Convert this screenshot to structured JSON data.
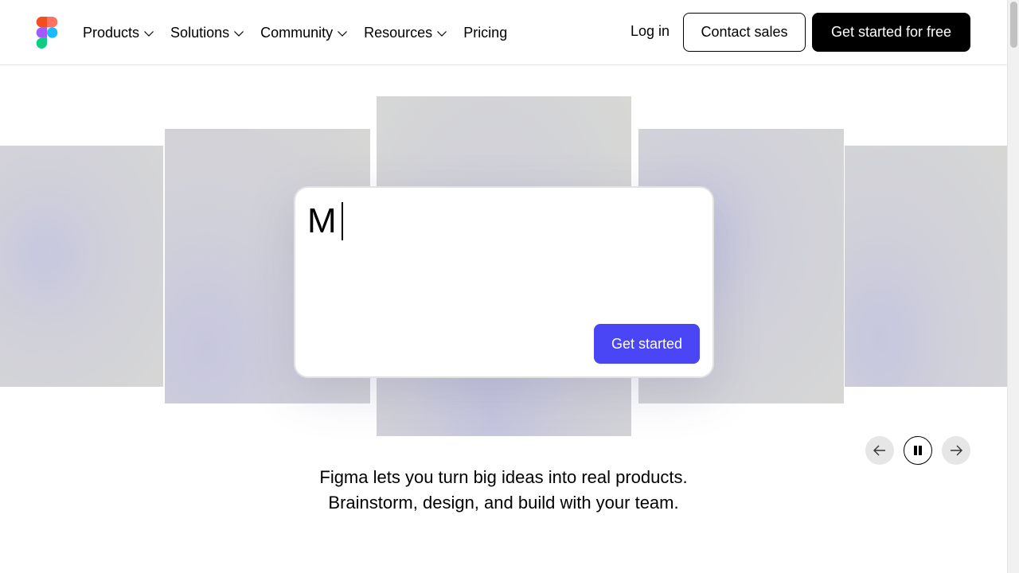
{
  "header": {
    "nav": [
      {
        "label": "Products",
        "has_dropdown": true
      },
      {
        "label": "Solutions",
        "has_dropdown": true
      },
      {
        "label": "Community",
        "has_dropdown": true
      },
      {
        "label": "Resources",
        "has_dropdown": true
      },
      {
        "label": "Pricing",
        "has_dropdown": false
      }
    ],
    "login_label": "Log in",
    "contact_label": "Contact sales",
    "cta_label": "Get started for free"
  },
  "hero": {
    "prompt_value": "M",
    "submit_label": "Get started",
    "tagline_line1": "Figma lets you turn big ideas into real products.",
    "tagline_line2": "Brainstorm, design, and build with your team."
  },
  "carousel": {
    "controls": [
      "arrow-left-icon",
      "pause-icon",
      "arrow-right-icon"
    ]
  },
  "colors": {
    "accent": "#4a46f5",
    "cta_bg": "#000000",
    "logo_red": "#f24e1e",
    "logo_orange": "#ff7262",
    "logo_purple": "#a259ff",
    "logo_blue": "#1abcfe",
    "logo_green": "#0acf83"
  }
}
